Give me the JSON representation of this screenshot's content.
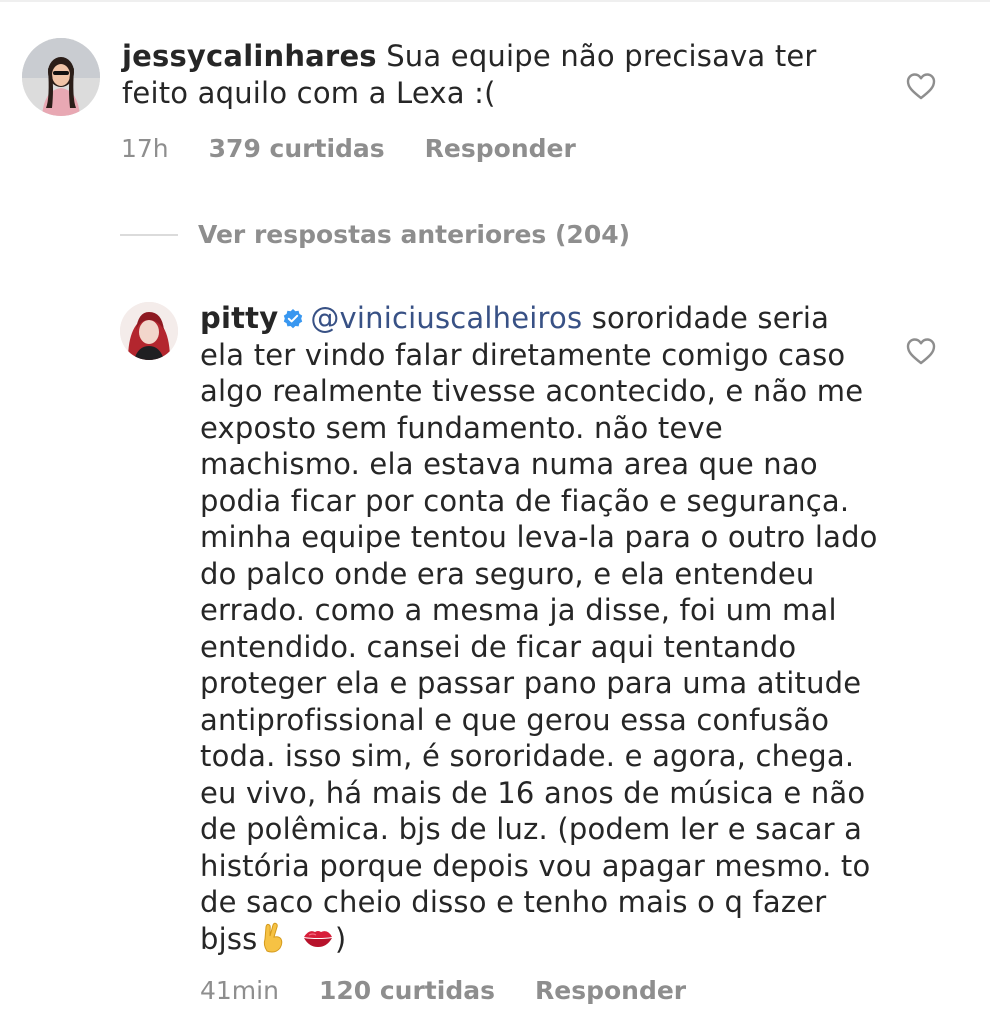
{
  "comments": [
    {
      "username": "jessycalinhares",
      "text": "Sua equipe não precisava ter feito aquilo com a Lexa :(",
      "time": "17h",
      "likes": "379 curtidas",
      "reply": "Responder"
    },
    {
      "username": "pitty",
      "verified": true,
      "mention": "@viniciuscalheiros",
      "text": "sororidade seria ela ter vindo falar diretamente comigo caso algo realmente tivesse acontecido, e não me exposto sem fundamento. não teve machismo. ela estava numa area que nao podia ficar por conta de fiação e segurança. minha equipe tentou leva-la para o outro lado do palco onde era seguro, e ela entendeu errado. como a mesma ja disse, foi um mal entendido. cansei de ficar aqui tentando proteger ela e passar pano para uma atitude antiprofissional e que gerou essa confusão toda. isso sim, é sororidade. e agora, chega. eu vivo, há mais de 16 anos de música e não de polêmica. bjs de luz. (podem ler e sacar a história porque depois vou apagar mesmo. to de saco cheio disso e tenho mais o q fazer bjss",
      "text_end": ")",
      "time": "41min",
      "likes": "120 curtidas",
      "reply": "Responder"
    }
  ],
  "view_previous": "Ver respostas anteriores (204)",
  "icons": {
    "heart": "heart-outline-icon",
    "verified": "verified-badge-icon",
    "emoji_1": "victory-hand-emoji",
    "emoji_2": "kiss-mark-emoji"
  },
  "colors": {
    "text": "#262626",
    "muted": "#8e8e8e",
    "mention": "#385185",
    "verified": "#3897f0"
  }
}
